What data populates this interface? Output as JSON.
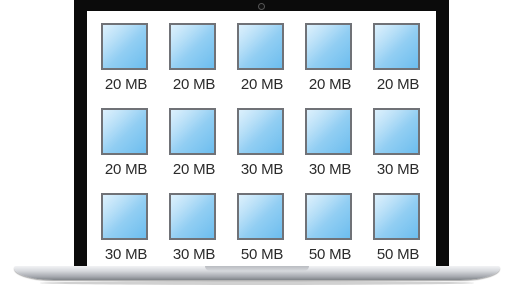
{
  "files": [
    {
      "size": "20 MB"
    },
    {
      "size": "20 MB"
    },
    {
      "size": "20 MB"
    },
    {
      "size": "20 MB"
    },
    {
      "size": "20 MB"
    },
    {
      "size": "20 MB"
    },
    {
      "size": "20 MB"
    },
    {
      "size": "30 MB"
    },
    {
      "size": "30 MB"
    },
    {
      "size": "30 MB"
    },
    {
      "size": "30 MB"
    },
    {
      "size": "30 MB"
    },
    {
      "size": "50 MB"
    },
    {
      "size": "50 MB"
    },
    {
      "size": "50 MB"
    }
  ],
  "colors": {
    "bezel": "#0b0b0b",
    "tile_fill": "#9ad2f4",
    "tile_border": "#707277",
    "label": "#2b2b2b"
  },
  "icons": {
    "file": "file-tile-icon",
    "camera": "camera-icon"
  }
}
